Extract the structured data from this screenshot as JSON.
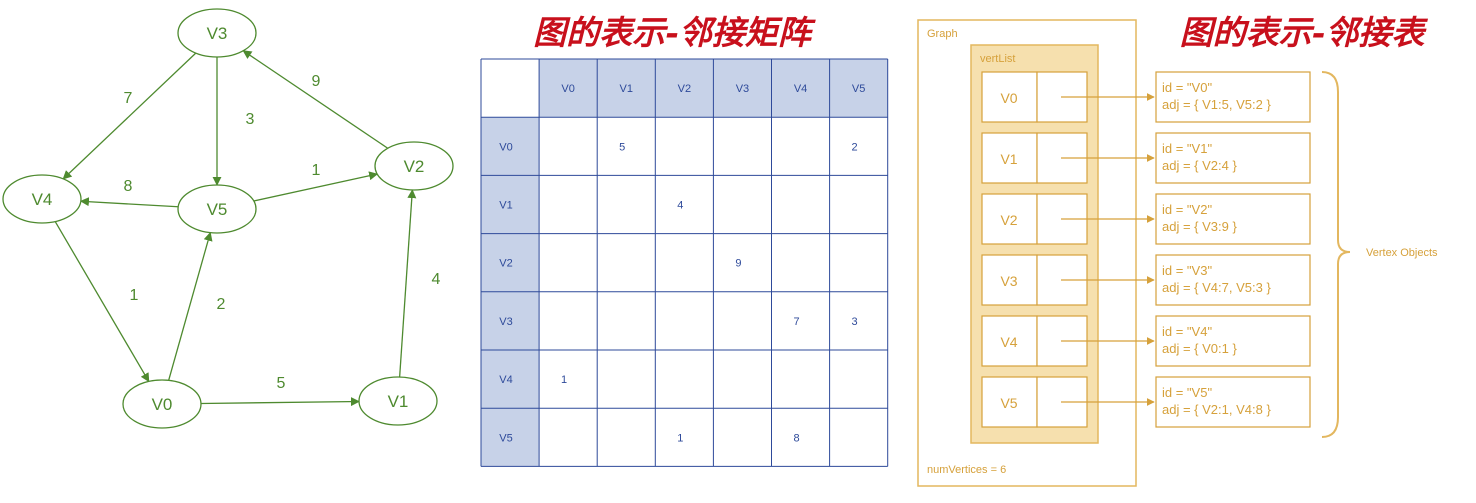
{
  "colors": {
    "graph": "#4e8a2f",
    "matrix_line": "#2e4a9a",
    "matrix_header": "#c7d2e8",
    "matrix_text": "#2e4a9a",
    "title": "#c8101c",
    "graph_box": "#e3b75f",
    "vert_fill": "#f6e0ae",
    "object_text": "#d6a13b"
  },
  "titles": {
    "matrix": "图的表示-邻接矩阵",
    "list": "图的表示-邻接表"
  },
  "graph": {
    "nodes": [
      {
        "id": "V0",
        "label": "V0"
      },
      {
        "id": "V1",
        "label": "V1"
      },
      {
        "id": "V2",
        "label": "V2"
      },
      {
        "id": "V3",
        "label": "V3"
      },
      {
        "id": "V4",
        "label": "V4"
      },
      {
        "id": "V5",
        "label": "V5"
      }
    ],
    "edges": [
      {
        "from": "V0",
        "to": "V1",
        "weight": "5"
      },
      {
        "from": "V0",
        "to": "V5",
        "weight": "2"
      },
      {
        "from": "V1",
        "to": "V2",
        "weight": "4"
      },
      {
        "from": "V2",
        "to": "V3",
        "weight": "9"
      },
      {
        "from": "V3",
        "to": "V4",
        "weight": "7"
      },
      {
        "from": "V3",
        "to": "V5",
        "weight": "3"
      },
      {
        "from": "V4",
        "to": "V0",
        "weight": "1"
      },
      {
        "from": "V5",
        "to": "V2",
        "weight": "1"
      },
      {
        "from": "V5",
        "to": "V4",
        "weight": "8"
      }
    ]
  },
  "matrix": {
    "headers": [
      "V0",
      "V1",
      "V2",
      "V3",
      "V4",
      "V5"
    ],
    "rows": [
      [
        "",
        "5",
        "",
        "",
        "",
        "2"
      ],
      [
        "",
        "",
        "4",
        "",
        "",
        ""
      ],
      [
        "",
        "",
        "",
        "9",
        "",
        ""
      ],
      [
        "",
        "",
        "",
        "",
        "7",
        "3"
      ],
      [
        "1",
        "",
        "",
        "",
        "",
        ""
      ],
      [
        "",
        "",
        "1",
        "",
        "8",
        ""
      ]
    ]
  },
  "adjlist": {
    "graph_label": "Graph",
    "vertlist_label": "vertList",
    "num_vertices_label": "numVertices = 6",
    "vertex_objects_label": "Vertex Objects",
    "vertices": [
      {
        "label": "V0",
        "id_line": "id = \"V0\"",
        "adj_line": "adj = { V1:5, V5:2 }"
      },
      {
        "label": "V1",
        "id_line": "id = \"V1\"",
        "adj_line": "adj = { V2:4 }"
      },
      {
        "label": "V2",
        "id_line": "id = \"V2\"",
        "adj_line": "adj = { V3:9 }"
      },
      {
        "label": "V3",
        "id_line": "id = \"V3\"",
        "adj_line": "adj = { V4:7, V5:3 }"
      },
      {
        "label": "V4",
        "id_line": "id = \"V4\"",
        "adj_line": "adj = { V0:1 }"
      },
      {
        "label": "V5",
        "id_line": "id = \"V5\"",
        "adj_line": "adj = { V2:1, V4:8 }"
      }
    ]
  }
}
